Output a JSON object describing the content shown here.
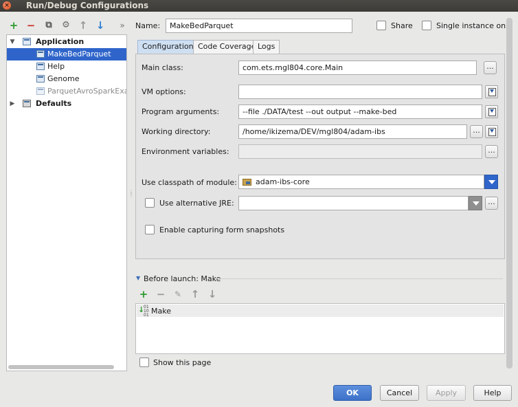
{
  "window": {
    "title": "Run/Debug Configurations"
  },
  "tree_toolbar": {
    "add": "+",
    "remove": "−",
    "copy": "⧉",
    "edit": "⚙",
    "up": "↑",
    "down": "↓",
    "more": "»"
  },
  "tree": {
    "items": [
      {
        "label": "Application",
        "bold": true,
        "expanded": true
      },
      {
        "label": "MakeBedParquet",
        "selected": true
      },
      {
        "label": "Help"
      },
      {
        "label": "Genome"
      },
      {
        "label": "ParquetAvroSparkExam",
        "dim": true
      },
      {
        "label": "Defaults",
        "bold": true,
        "expanded": false
      }
    ]
  },
  "name_row": {
    "label": "Name:",
    "value": "MakeBedParquet",
    "share_label": "Share",
    "single_instance_label": "Single instance only"
  },
  "tabs": [
    {
      "label": "Configuration",
      "active": true
    },
    {
      "label": "Code Coverage"
    },
    {
      "label": "Logs"
    }
  ],
  "form": {
    "main_class": {
      "label": "Main class:",
      "value": "com.ets.mgl804.core.Main"
    },
    "vm_options": {
      "label": "VM options:",
      "value": ""
    },
    "program_arguments": {
      "label": "Program arguments:",
      "value": "--file ./DATA/test --out output --make-bed"
    },
    "working_directory": {
      "label": "Working directory:",
      "value": "/home/ikizema/DEV/mgl804/adam-ibs"
    },
    "environment_variables": {
      "label": "Environment variables:",
      "value": ""
    },
    "classpath_module": {
      "label": "Use classpath of module:",
      "value": "adam-ibs-core"
    },
    "alternative_jre": {
      "label": "Use alternative JRE:",
      "value": ""
    },
    "form_snapshots": {
      "label": "Enable capturing form snapshots"
    },
    "ellipsis": "..."
  },
  "before_launch": {
    "title": "Before launch: Make",
    "items": [
      "Make"
    ],
    "show_page_label": "Show this page"
  },
  "buttons": {
    "ok": "OK",
    "cancel": "Cancel",
    "apply": "Apply",
    "help": "Help"
  },
  "colors": {
    "accent": "#2f65ca",
    "selection": "#2f65ca",
    "title_bar": "#3c3b37",
    "close_button": "#e2572b",
    "add_green": "#2e9a2e",
    "remove_red": "#c8332b"
  }
}
